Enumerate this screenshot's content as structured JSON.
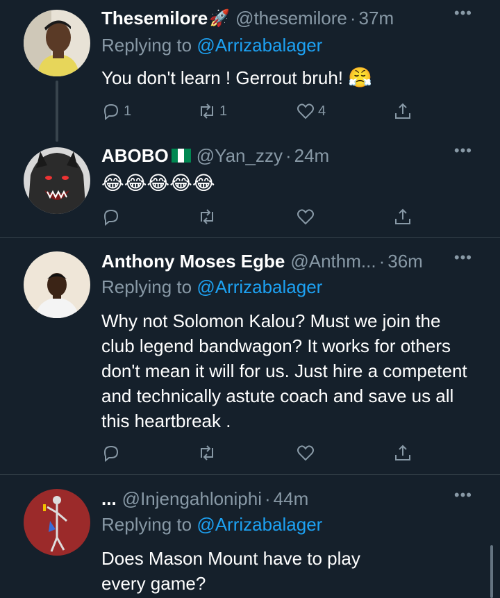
{
  "tweets": [
    {
      "name": "Thesemilore",
      "handle": "@thesemilore",
      "dot": "·",
      "time": "37m",
      "replying_prefix": "Replying to",
      "replying_to": "@Arrizabalager",
      "text": "You don't learn ! Gerrout bruh!",
      "emoji": "😤",
      "reply_count": "1",
      "retweet_count": "1",
      "like_count": "4"
    },
    {
      "name": "ABOBO",
      "handle": "@Yan_zzy",
      "dot": "·",
      "time": "24m",
      "emoji_row": "😂😂😂😂😂"
    },
    {
      "name": "Anthony Moses Egbe",
      "handle": "@Anthm...",
      "dot": "·",
      "time": "36m",
      "replying_prefix": "Replying to",
      "replying_to": "@Arrizabalager",
      "text": "Why not Solomon Kalou? Must we join the club legend bandwagon? It works for others don't mean it will for us. Just hire a competent and technically astute coach and save us all this heartbreak ."
    },
    {
      "name": "...",
      "handle": "@Injengahloniphi",
      "dot": "·",
      "time": "44m",
      "replying_prefix": "Replying to",
      "replying_to": "@Arrizabalager",
      "text": "Does Mason Mount have to play every game?"
    }
  ],
  "more_label": "•••",
  "colors": {
    "background": "#15202b",
    "accent": "#1da1f2",
    "secondary": "#8899a6"
  },
  "icons": [
    "reply-icon",
    "retweet-icon",
    "like-icon",
    "share-icon",
    "more-icon",
    "rocket-icon",
    "nigeria-flag-icon"
  ]
}
